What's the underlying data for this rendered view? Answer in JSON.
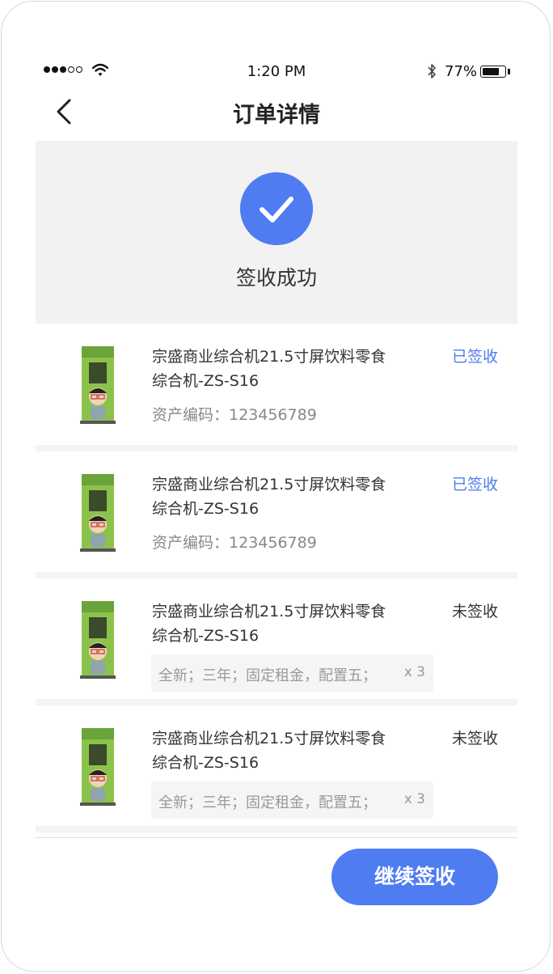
{
  "status_bar": {
    "time": "1:20 PM",
    "battery_percent": "77%",
    "battery_level": 0.77,
    "signal_icon": "signal-dots-icon",
    "wifi_icon": "wifi-icon",
    "bluetooth_icon": "bluetooth-icon"
  },
  "nav": {
    "back_icon": "chevron-left-icon",
    "title": "订单详情"
  },
  "success": {
    "icon": "check-circle-icon",
    "message": "签收成功"
  },
  "colors": {
    "accent": "#4f7cf1",
    "panel_bg": "#f2f2f2",
    "divider": "#f4f4f4"
  },
  "items": [
    {
      "name": "宗盛商业综合机21.5寸屏饮料零食综合机-ZS-S16",
      "asset_label": "资产编码：",
      "asset_code": "123456789",
      "status": "已签收"
    },
    {
      "name": "宗盛商业综合机21.5寸屏饮料零食综合机-ZS-S16",
      "asset_label": "资产编码：",
      "asset_code": "123456789",
      "status": "已签收"
    },
    {
      "name": "宗盛商业综合机21.5寸屏饮料零食综合机-ZS-S16",
      "spec": "全新；三年；固定租金，配置五；",
      "quantity": "x 3",
      "status": "未签收"
    },
    {
      "name": "宗盛商业综合机21.5寸屏饮料零食综合机-ZS-S16",
      "spec": "全新；三年；固定租金，配置五；",
      "quantity": "x 3",
      "status": "未签收"
    }
  ],
  "footer": {
    "continue_label": "继续签收"
  }
}
